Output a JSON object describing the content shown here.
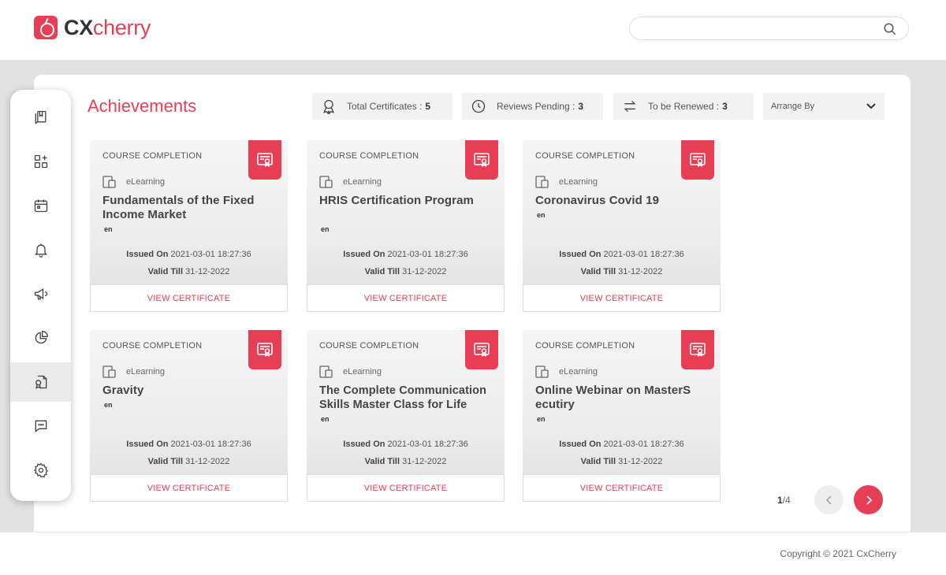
{
  "app": {
    "logo_prefix": "CX",
    "logo_suffix": "cherry",
    "brand_color": "#e83e55"
  },
  "search": {
    "placeholder": "",
    "value": ""
  },
  "sidebar": {
    "items": [
      {
        "icon": "bookmark-icon",
        "active": false
      },
      {
        "icon": "apps-add-icon",
        "active": false
      },
      {
        "icon": "calendar-icon",
        "active": false
      },
      {
        "icon": "bell-icon",
        "active": false
      },
      {
        "icon": "megaphone-icon",
        "active": false
      },
      {
        "icon": "pie-chart-icon",
        "active": false
      },
      {
        "icon": "certificate-file-icon",
        "active": true
      },
      {
        "icon": "chat-icon",
        "active": false
      },
      {
        "icon": "gear-icon",
        "active": false
      }
    ]
  },
  "main": {
    "title": "Achievements",
    "stats": {
      "total": {
        "label": "Total Certificates :",
        "value": "5"
      },
      "pending": {
        "label": "Reviews Pending :",
        "value": "3"
      },
      "renew": {
        "label": "To be Renewed :",
        "value": "3"
      }
    },
    "arrange_by": "Arrange By"
  },
  "cards": [
    {
      "type": "COURSE COMPLETION",
      "mode": "eLearning",
      "title": "Fundamentals of the Fixed Income Market",
      "lang": "en",
      "issued_label": "Issued On",
      "issued": "2021-03-01 18:27:36",
      "valid_label": "Valid Till",
      "valid": "31-12-2022",
      "button": "VIEW CERTIFICATE"
    },
    {
      "type": "COURSE COMPLETION",
      "mode": "eLearning",
      "title": "HRIS Certification Program",
      "lang": "en",
      "issued_label": "Issued On",
      "issued": "2021-03-01 18:27:36",
      "valid_label": "Valid Till",
      "valid": "31-12-2022",
      "button": "VIEW CERTIFICATE"
    },
    {
      "type": "COURSE COMPLETION",
      "mode": "eLearning",
      "title": "Coronavirus Covid 19",
      "lang": "en",
      "issued_label": "Issued On",
      "issued": "2021-03-01 18:27:36",
      "valid_label": "Valid Till",
      "valid": "31-12-2022",
      "button": "VIEW CERTIFICATE"
    },
    {
      "type": "COURSE COMPLETION",
      "mode": "eLearning",
      "title": "Gravity",
      "lang": "en",
      "issued_label": "Issued On",
      "issued": "2021-03-01 18:27:36",
      "valid_label": "Valid Till",
      "valid": "31-12-2022",
      "button": "VIEW CERTIFICATE"
    },
    {
      "type": "COURSE COMPLETION",
      "mode": "eLearning",
      "title": "The Complete Communication Skills Master Class for Life",
      "lang": "en",
      "issued_label": "Issued On",
      "issued": "2021-03-01 18:27:36",
      "valid_label": "Valid Till",
      "valid": "31-12-2022",
      "button": "VIEW CERTIFICATE"
    },
    {
      "type": "COURSE COMPLETION",
      "mode": "eLearning",
      "title": "Online Webinar on MasterS ecutiry",
      "lang": "en",
      "issued_label": "Issued On",
      "issued": "2021-03-01 18:27:36",
      "valid_label": "Valid Till",
      "valid": "31-12-2022",
      "button": "VIEW CERTIFICATE"
    }
  ],
  "pagination": {
    "current": "1",
    "total": "/4"
  },
  "footer": {
    "copyright": "Copyright © 2021 CxCherry"
  }
}
